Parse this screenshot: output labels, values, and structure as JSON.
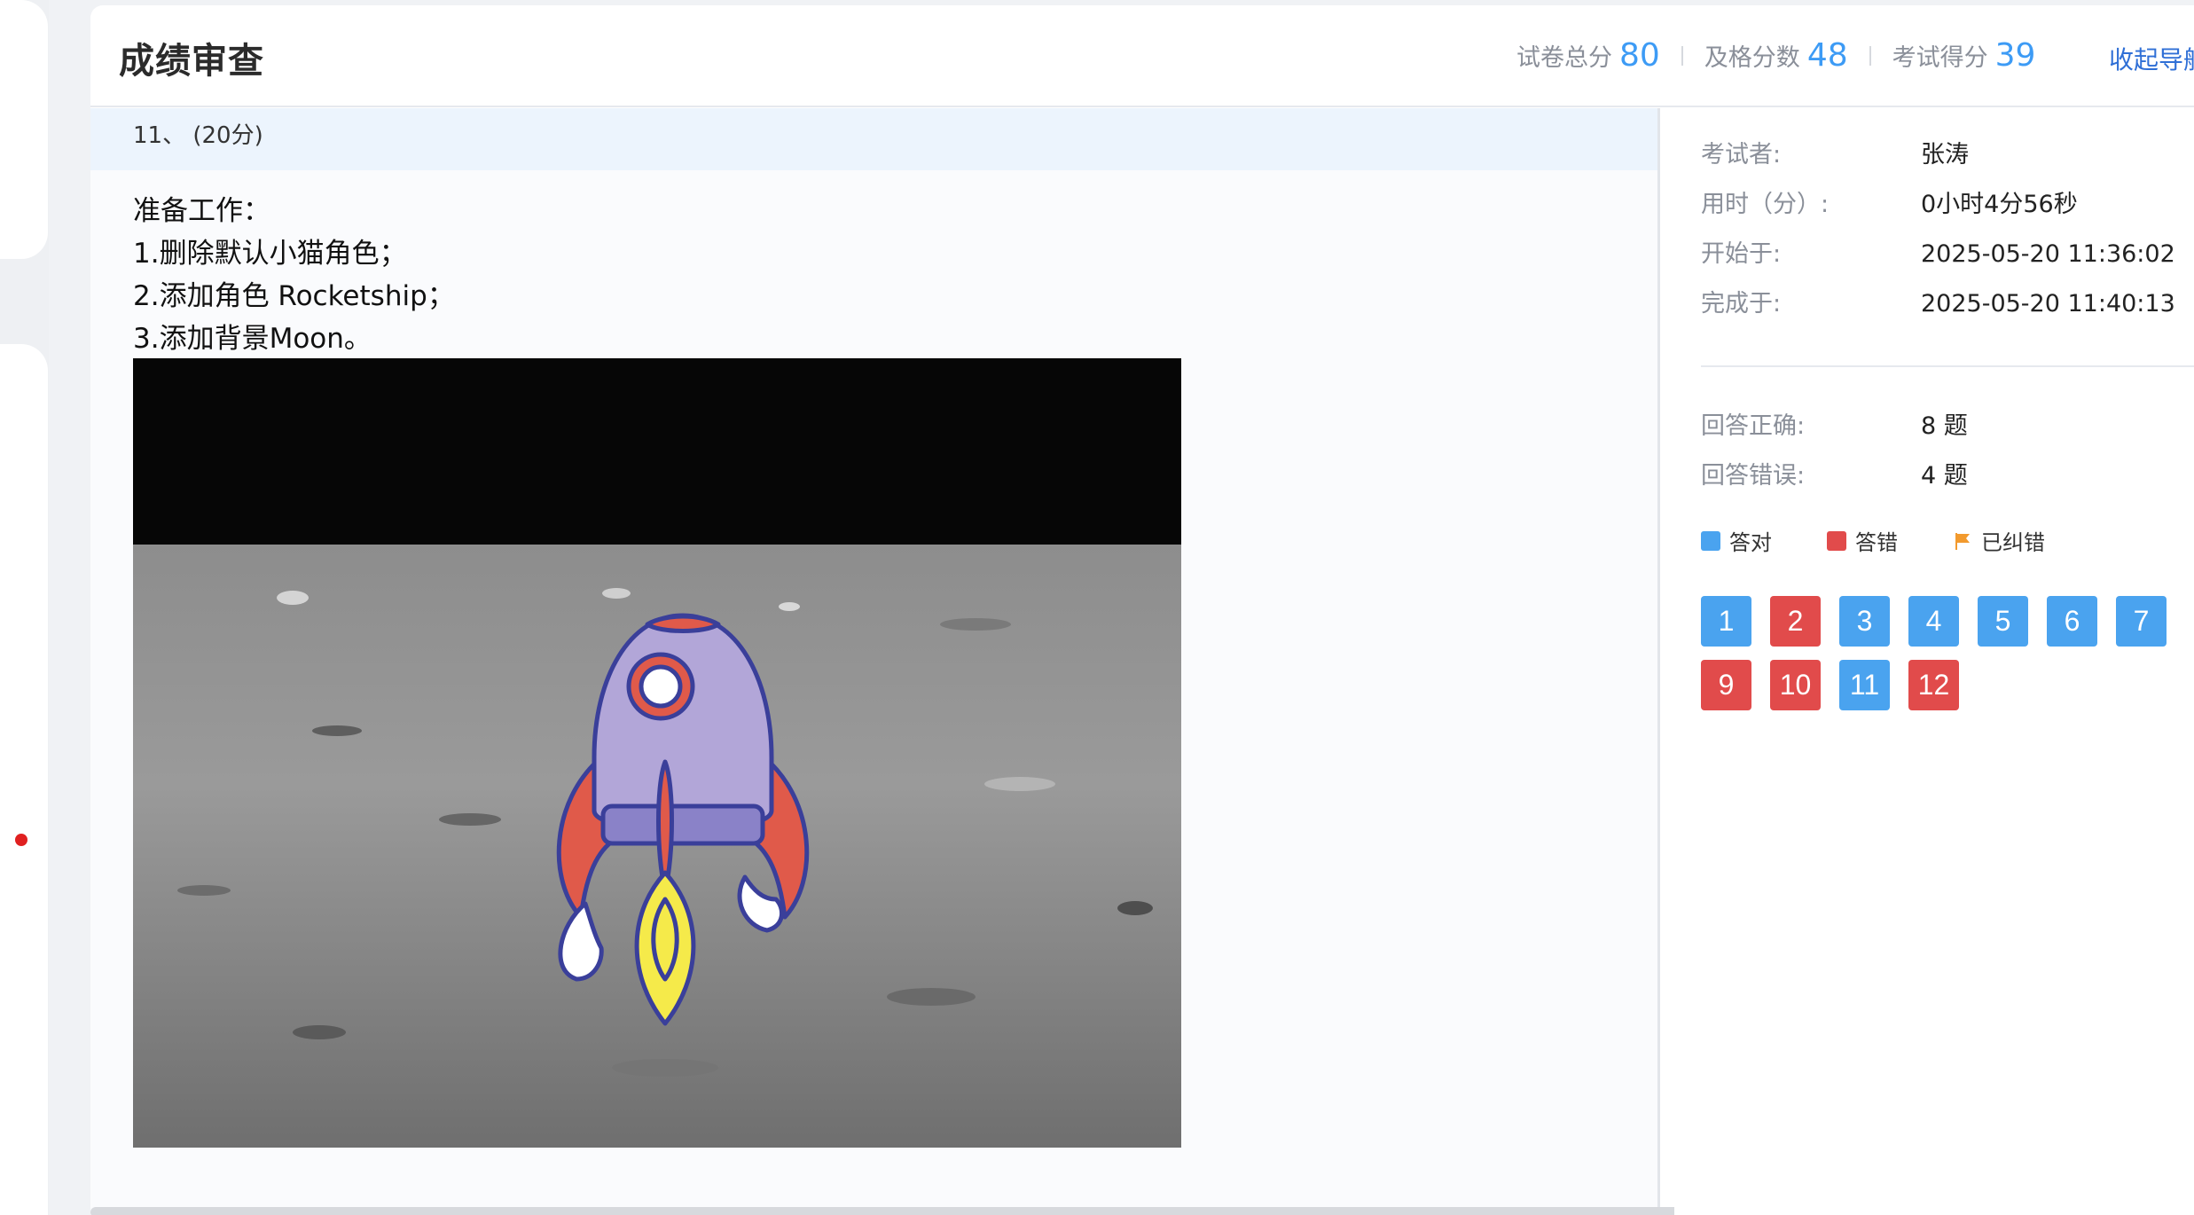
{
  "page": {
    "title": "成绩审查",
    "collapse_nav": "收起导航"
  },
  "stats": {
    "total_label": "试卷总分",
    "total_value": "80",
    "pass_label": "及格分数",
    "pass_value": "48",
    "score_label": "考试得分",
    "score_value": "39"
  },
  "question": {
    "number": "11、 (20分)",
    "instructions": [
      "准备工作：",
      "1.删除默认小猫角色；",
      "2.添加角色 Rocketship；",
      "3.添加背景Moon。"
    ]
  },
  "info": {
    "examinee_label": "考试者:",
    "examinee_value": "张涛",
    "duration_label": "用时（分）:",
    "duration_value": "0小时4分56秒",
    "start_label": "开始于:",
    "start_value": "2025-05-20 11:36:02",
    "finish_label": "完成于:",
    "finish_value": "2025-05-20 11:40:13",
    "correct_label": "回答正确:",
    "correct_value": "8 题",
    "wrong_label": "回答错误:",
    "wrong_value": "4 题"
  },
  "legend": {
    "correct": "答对",
    "wrong": "答错",
    "corrected": "已纠错",
    "colors": {
      "correct": "#4aa3ef",
      "wrong": "#e14b4b",
      "corrected": "#f29a2e"
    }
  },
  "questions": [
    {
      "n": "1",
      "status": "correct"
    },
    {
      "n": "2",
      "status": "wrong"
    },
    {
      "n": "3",
      "status": "correct"
    },
    {
      "n": "4",
      "status": "correct"
    },
    {
      "n": "5",
      "status": "correct"
    },
    {
      "n": "6",
      "status": "correct"
    },
    {
      "n": "7",
      "status": "correct"
    },
    {
      "n": "9",
      "status": "wrong"
    },
    {
      "n": "10",
      "status": "wrong"
    },
    {
      "n": "11",
      "status": "correct"
    },
    {
      "n": "12",
      "status": "wrong"
    }
  ]
}
